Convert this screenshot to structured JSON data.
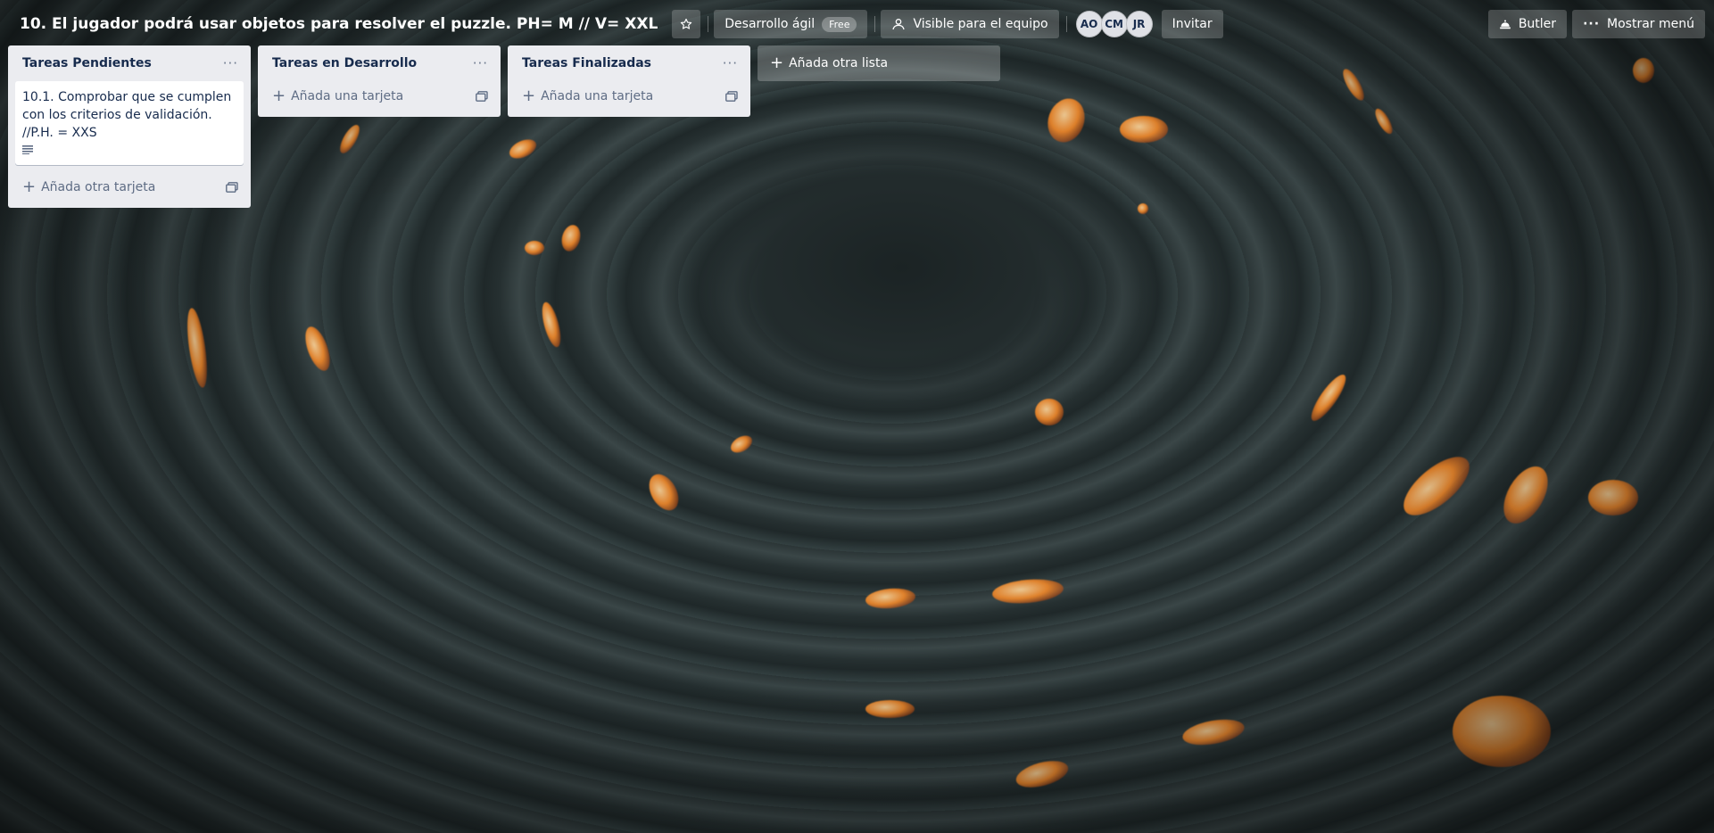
{
  "header": {
    "board_title": "10. El jugador podrá usar objetos para resolver el puzzle. PH= M // V= XXL",
    "workspace_label": "Desarrollo ágil",
    "workspace_badge": "Free",
    "visibility_label": "Visible para el equipo",
    "members": [
      "AO",
      "CM",
      "JR"
    ],
    "invite_label": "Invitar",
    "butler_label": "Butler",
    "menu_label": "Mostrar menú"
  },
  "lists": [
    {
      "title": "Tareas Pendientes",
      "cards": [
        {
          "text": "10.1. Comprobar que se cumplen con los criterios de validación. //P.H. = XXS",
          "has_description": true
        }
      ],
      "add_label": "Añada otra tarjeta"
    },
    {
      "title": "Tareas en Desarrollo",
      "cards": [],
      "add_label": "Añada una tarjeta"
    },
    {
      "title": "Tareas Finalizadas",
      "cards": [],
      "add_label": "Añada una tarjeta"
    }
  ],
  "add_list_label": "Añada otra lista",
  "colors": {
    "list_bg": "#ebecf0",
    "text_primary": "#172b4d",
    "text_muted": "#5e6c84",
    "background": "#222a2b",
    "ember": "#f2892a"
  },
  "icons": [
    "star-icon",
    "team-icon",
    "butler-icon",
    "more-dots-icon",
    "plus-icon",
    "template-icon",
    "description-icon"
  ]
}
